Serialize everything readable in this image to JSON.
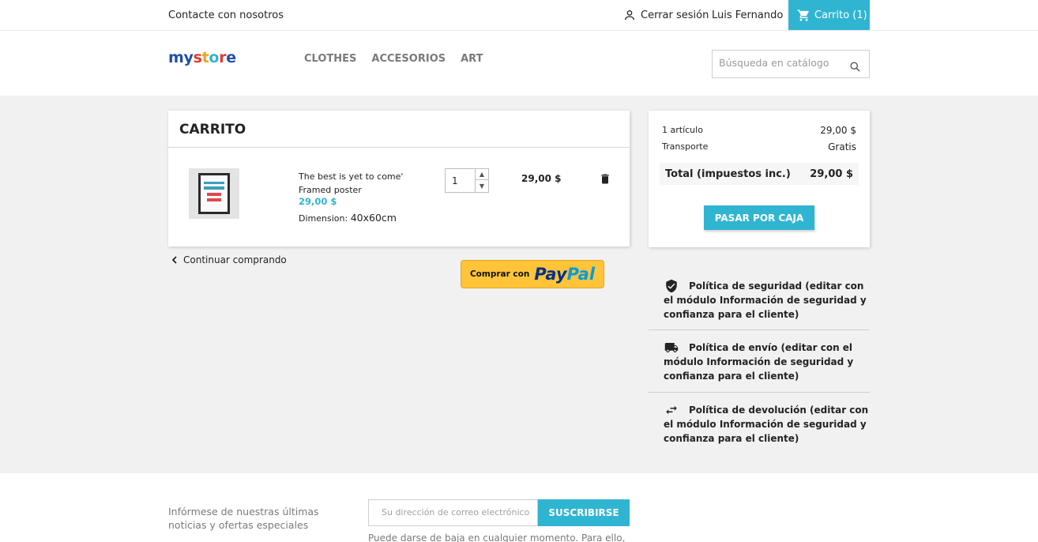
{
  "topbar": {
    "contact": "Contacte con nosotros",
    "signout": "Cerrar sesión",
    "username": "Luis Fernando",
    "cart": "Carrito (1)"
  },
  "header": {
    "logo": [
      "m",
      "y",
      " ",
      "s",
      "t",
      "o",
      "r",
      "e"
    ],
    "nav": [
      "CLOTHES",
      "ACCESORIOS",
      "ART"
    ],
    "search_placeholder": "Búsqueda en catálogo"
  },
  "cart": {
    "title": "CARRITO",
    "product": {
      "name": "The best is yet to come' Framed poster",
      "price": "29,00 $",
      "attr_label": "Dimension:",
      "attr_value": "40x60cm",
      "quantity": "1",
      "line_total": "29,00 $"
    },
    "continue": "Continuar comprando",
    "paypal_pre": "Comprar con",
    "paypal_brand_1": "Pay",
    "paypal_brand_2": "Pal"
  },
  "summary": {
    "items_label": "1 artículo",
    "items_value": "29,00 $",
    "shipping_label": "Transporte",
    "shipping_value": "Gratis",
    "total_label": "Total (impuestos inc.)",
    "total_value": "29,00 $",
    "checkout": "PASAR POR CAJA"
  },
  "reassurance": [
    "Política de seguridad (editar con el módulo Información de seguridad y confianza para el cliente)",
    "Política de envío (editar con el módulo Información de seguridad y confianza para el cliente)",
    "Política de devolución (editar con el módulo Información de seguridad y confianza para el cliente)"
  ],
  "footer": {
    "news_label": "Infórmese de nuestras últimas noticias y ofertas especiales",
    "email_placeholder": "Su dirección de correo electrónico",
    "subscribe": "SUSCRIBIRSE",
    "unsubscribe": "Puede darse de baja en cualquier momento. Para ello,"
  },
  "colors": {
    "accent": "#2fb5d2",
    "paypal_yellow": "#ffc439",
    "main_bg": "#f1f1f1"
  }
}
